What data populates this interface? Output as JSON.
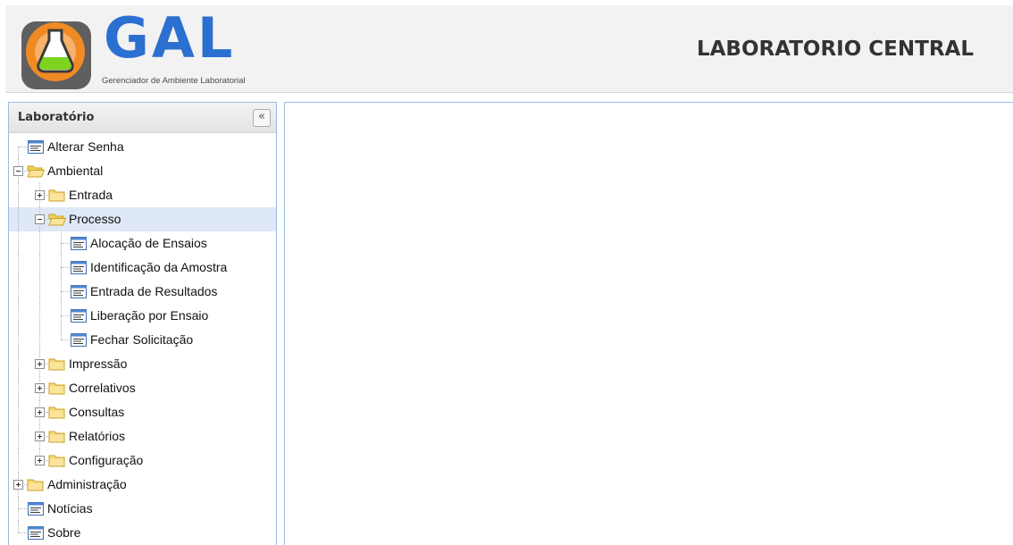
{
  "header": {
    "logo_word": "GAL",
    "logo_subtitle": "Gerenciador de Ambiente Laboratorial",
    "title": "LABORATORIO CENTRAL"
  },
  "sidebar": {
    "title": "Laboratório",
    "collapse_button": "«",
    "tree": [
      {
        "label": "Alterar Senha",
        "type": "leaf",
        "level": 0
      },
      {
        "label": "Ambiental",
        "type": "folder",
        "expanded": true,
        "level": 0
      },
      {
        "label": "Entrada",
        "type": "folder",
        "expanded": false,
        "level": 1
      },
      {
        "label": "Processo",
        "type": "folder",
        "expanded": true,
        "level": 1,
        "selected": true
      },
      {
        "label": "Alocação de Ensaios",
        "type": "leaf",
        "level": 2
      },
      {
        "label": "Identificação da Amostra",
        "type": "leaf",
        "level": 2
      },
      {
        "label": "Entrada de Resultados",
        "type": "leaf",
        "level": 2
      },
      {
        "label": "Liberação por Ensaio",
        "type": "leaf",
        "level": 2
      },
      {
        "label": "Fechar Solicitação",
        "type": "leaf",
        "level": 2
      },
      {
        "label": "Impressão",
        "type": "folder",
        "expanded": false,
        "level": 1
      },
      {
        "label": "Correlativos",
        "type": "folder",
        "expanded": false,
        "level": 1
      },
      {
        "label": "Consultas",
        "type": "folder",
        "expanded": false,
        "level": 1
      },
      {
        "label": "Relatórios",
        "type": "folder",
        "expanded": false,
        "level": 1
      },
      {
        "label": "Configuração",
        "type": "folder",
        "expanded": false,
        "level": 1
      },
      {
        "label": "Administração",
        "type": "folder",
        "expanded": false,
        "level": 0
      },
      {
        "label": "Notícias",
        "type": "leaf",
        "level": 0
      },
      {
        "label": "Sobre",
        "type": "leaf",
        "level": 0
      }
    ]
  },
  "colors": {
    "logo_blue": "#2b6fd0",
    "logo_orange": "#f08a24",
    "folder_yellow": "#f7d774",
    "selected_row": "#dfe8f6",
    "panel_border": "#99bbe8"
  }
}
